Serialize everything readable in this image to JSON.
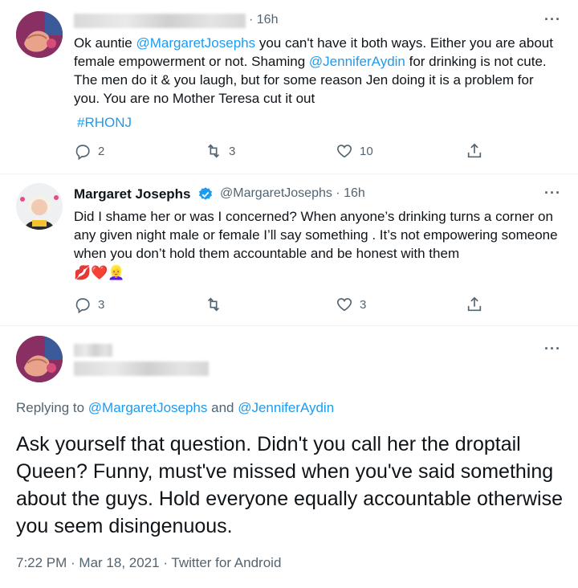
{
  "tweet1": {
    "time": "16h",
    "text_prefix": "Ok auntie ",
    "mention_margaret": "@MargaretJosephs",
    "text_mid": " you can't have it both ways. Either you are about female empowerment or not. Shaming ",
    "mention_jennifer": "@JenniferAydin",
    "text_suffix": " for drinking is not cute. The men do it & you laugh, but for some reason Jen doing it is a problem for you. You are no Mother Teresa cut it out",
    "hashtag": "#RHONJ",
    "replies": "2",
    "retweets": "3",
    "likes": "10"
  },
  "tweet2": {
    "name": "Margaret Josephs",
    "handle": "@MargaretJosephs",
    "time": "16h",
    "text": "Did I shame her or was I concerned? When anyone’s drinking turns a corner on any given night male or female I’ll say something . It’s not empowering someone when you don’t hold them accountable and be honest with them",
    "emojis": "💋❤️👱‍♀️",
    "replies": "3",
    "likes": "3"
  },
  "tweet3": {
    "replying_prefix": "Replying to ",
    "reply_to_1": "@MargaretJosephs",
    "reply_and": " and ",
    "reply_to_2": "@JenniferAydin",
    "text": "Ask yourself that question.  Didn't you call her the droptail Queen?  Funny, must've missed when you've said something about the guys. Hold everyone equally accountable otherwise you seem disingenuous.",
    "timestamp": "7:22 PM · Mar 18, 2021 · Twitter for Android"
  },
  "icons": {
    "more": "more-icon",
    "reply": "reply-icon",
    "retweet": "retweet-icon",
    "like": "heart-icon",
    "share": "share-icon",
    "verified": "verified-badge-icon"
  },
  "colors": {
    "link": "#1d9bf0",
    "muted": "#536471",
    "text": "#0f1419"
  }
}
